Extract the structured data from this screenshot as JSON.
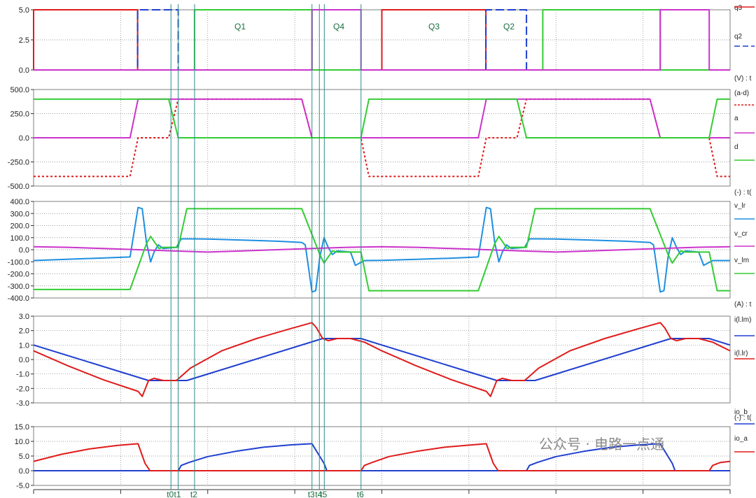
{
  "colors": {
    "grid": "#7f7f7f",
    "marker": "#2e8b8b",
    "q2": "#1f3fd0",
    "q3": "#e01b1b",
    "q1": "#33cc33",
    "q4": "#cc33cc"
  },
  "watermark": "公众号 · 电路一点通",
  "markers": [
    {
      "name": "t0",
      "t": 0.1972
    },
    {
      "name": "t1",
      "t": 0.2076
    },
    {
      "name": "t2",
      "t": 0.2311
    },
    {
      "name": "t3",
      "t": 0.3997
    },
    {
      "name": "t4",
      "t": 0.4103
    },
    {
      "name": "t5",
      "t": 0.4174
    },
    {
      "name": "t6",
      "t": 0.4701
    }
  ],
  "chart_data": [
    {
      "type": "line",
      "panel": "gate-drive",
      "title": "",
      "xlabel": "",
      "ylabel": "",
      "ylim": [
        0,
        5
      ],
      "yticks": [
        "5.0",
        "2.5",
        "0.0"
      ],
      "grid": true,
      "legend_position": "right",
      "annotations": [
        "Q1",
        "Q4",
        "Q3",
        "Q2"
      ],
      "series": [
        {
          "name": "q3",
          "color": "#e01b1b",
          "dash": "solid",
          "x": [
            0,
            0.0,
            0.0,
            0.1493,
            0.1493,
            0.5,
            0.5,
            0.6493,
            0.6493,
            1.0
          ],
          "y": [
            0,
            0,
            5,
            5,
            0,
            0,
            5,
            5,
            0,
            0
          ]
        },
        {
          "name": "q2",
          "color": "#1f3fd0",
          "dash": "dashed",
          "x": [
            0,
            0.1493,
            0.1493,
            0.2076,
            0.2076,
            0.6493,
            0.6493,
            0.7076,
            0.7076,
            1.0
          ],
          "y": [
            0,
            0,
            5,
            5,
            0,
            0,
            5,
            5,
            0,
            0
          ]
        },
        {
          "name": "Q1",
          "color": "#33cc33",
          "dash": "solid",
          "x": [
            0,
            0.2311,
            0.2311,
            0.3997,
            0.3997,
            0.7311,
            0.7311,
            0.8997,
            0.8997,
            1.0
          ],
          "y": [
            0,
            0,
            5,
            5,
            0,
            0,
            5,
            5,
            0,
            0
          ]
        },
        {
          "name": "Q4",
          "color": "#cc33cc",
          "dash": "solid",
          "x": [
            0,
            0.3997,
            0.3997,
            0.4701,
            0.4701,
            0.8997,
            0.8997,
            0.9701,
            0.9701,
            1.0
          ],
          "y": [
            0,
            0,
            5,
            5,
            0,
            0,
            5,
            5,
            0,
            0
          ]
        }
      ]
    },
    {
      "type": "line",
      "panel": "bridge-voltages",
      "title": "(V) : t",
      "xlabel": "",
      "ylabel": "",
      "ylim": [
        -500,
        500
      ],
      "yticks": [
        "500.0",
        "250.0",
        "0.0",
        "-250.0",
        "-500.0"
      ],
      "grid": true,
      "legend_position": "right",
      "series": [
        {
          "name": "(a-d)",
          "color": "#e01b1b",
          "dash": "dotted",
          "x": [
            0,
            0.1385,
            0.1499,
            0.194,
            0.2076,
            0.385,
            0.3997,
            0.47,
            0.4814,
            0.6385,
            0.6499,
            0.694,
            0.7076,
            0.885,
            0.8997,
            0.97,
            0.9814,
            1.0
          ],
          "y": [
            -400,
            -400,
            0,
            0,
            400,
            400,
            0,
            0,
            -400,
            -400,
            0,
            0,
            400,
            400,
            0,
            0,
            -400,
            -400
          ]
        },
        {
          "name": "a",
          "color": "#cc33cc",
          "dash": "solid",
          "x": [
            0,
            0.1385,
            0.1499,
            0.385,
            0.3997,
            0.6385,
            0.6499,
            0.885,
            0.8997,
            1.0
          ],
          "y": [
            0,
            0,
            400,
            400,
            0,
            0,
            400,
            400,
            0,
            0
          ]
        },
        {
          "name": "d",
          "color": "#33cc33",
          "dash": "solid",
          "x": [
            0,
            0.194,
            0.2076,
            0.47,
            0.4814,
            0.694,
            0.7076,
            0.97,
            0.9814,
            1.0
          ],
          "y": [
            400,
            400,
            0,
            0,
            400,
            400,
            0,
            0,
            400,
            400
          ]
        }
      ]
    },
    {
      "type": "line",
      "panel": "resonant-voltages",
      "title": "(-) : t(",
      "xlabel": "",
      "ylabel": "",
      "ylim": [
        -400,
        400
      ],
      "yticks": [
        "400.0",
        "300.0",
        "200.0",
        "100.0",
        "0.0",
        "-100.0",
        "-200.0",
        "-300.0",
        "-400.0"
      ],
      "grid": true,
      "legend_position": "right",
      "series": [
        {
          "name": "v_lr",
          "color": "#1e8fe0",
          "dash": "solid",
          "x": [
            0,
            0.1385,
            0.1499,
            0.156,
            0.162,
            0.168,
            0.173,
            0.179,
            0.186,
            0.205,
            0.212,
            0.225,
            0.25,
            0.3,
            0.35,
            0.385,
            0.39,
            0.3997,
            0.405,
            0.411,
            0.417,
            0.423,
            0.429,
            0.436,
            0.455,
            0.462,
            0.475,
            0.5,
            0.55,
            0.6,
            0.6385,
            0.6499,
            0.656,
            0.662,
            0.668,
            0.673,
            0.679,
            0.686,
            0.705,
            0.712,
            0.725,
            0.75,
            0.8,
            0.85,
            0.885,
            0.89,
            0.8997,
            0.905,
            0.911,
            0.917,
            0.923,
            0.929,
            0.936,
            0.955,
            0.962,
            0.975,
            1.0
          ],
          "y": [
            -90,
            -60,
            350,
            340,
            60,
            -100,
            -20,
            40,
            10,
            20,
            90,
            90,
            88,
            80,
            70,
            60,
            40,
            -350,
            -340,
            -60,
            100,
            20,
            -40,
            -10,
            -20,
            -130,
            -90,
            -88,
            -80,
            -70,
            -60,
            350,
            340,
            60,
            -100,
            -20,
            40,
            10,
            20,
            90,
            90,
            88,
            80,
            70,
            60,
            40,
            -350,
            -340,
            -60,
            100,
            20,
            -40,
            -10,
            -20,
            -130,
            -90,
            -90
          ]
        },
        {
          "name": "v_cr",
          "color": "#cc33cc",
          "dash": "solid",
          "x": [
            0,
            0.05,
            0.1,
            0.15,
            0.2,
            0.25,
            0.3,
            0.35,
            0.4,
            0.45,
            0.5,
            0.55,
            0.6,
            0.65,
            0.7,
            0.75,
            0.8,
            0.85,
            0.9,
            0.95,
            1.0
          ],
          "y": [
            25,
            20,
            10,
            0,
            -10,
            -20,
            -10,
            0,
            10,
            20,
            25,
            20,
            10,
            0,
            -10,
            -20,
            -10,
            0,
            10,
            20,
            25
          ]
        },
        {
          "name": "v_lm",
          "color": "#33cc33",
          "dash": "solid",
          "x": [
            0,
            0.1385,
            0.162,
            0.168,
            0.174,
            0.18,
            0.186,
            0.2076,
            0.22,
            0.385,
            0.411,
            0.417,
            0.423,
            0.429,
            0.436,
            0.4701,
            0.4814,
            0.6385,
            0.662,
            0.668,
            0.674,
            0.68,
            0.686,
            0.7076,
            0.72,
            0.885,
            0.911,
            0.917,
            0.923,
            0.929,
            0.936,
            0.9701,
            0.9814,
            1.0
          ],
          "y": [
            -330,
            -330,
            50,
            110,
            60,
            10,
            20,
            20,
            340,
            340,
            -40,
            -110,
            -60,
            -10,
            -20,
            -20,
            -340,
            -340,
            50,
            110,
            60,
            10,
            20,
            20,
            340,
            340,
            -40,
            -110,
            -60,
            -10,
            -20,
            -20,
            -340,
            -340
          ]
        }
      ]
    },
    {
      "type": "line",
      "panel": "inductor-currents",
      "title": "(A) : t",
      "xlabel": "",
      "ylabel": "",
      "ylim": [
        -3,
        3
      ],
      "yticks": [
        "3.0",
        "2.0",
        "1.0",
        "0.0",
        "-1.0",
        "-2.0",
        "-3.0"
      ],
      "grid": true,
      "legend_position": "right",
      "series": [
        {
          "name": "i(l.lm)",
          "color": "#1f3fd0",
          "dash": "solid",
          "x": [
            0,
            0.165,
            0.22,
            0.415,
            0.47,
            0.5,
            0.665,
            0.72,
            0.915,
            0.97,
            1.0
          ],
          "y": [
            1.0,
            -1.45,
            -1.45,
            1.45,
            1.45,
            1.0,
            -1.45,
            -1.45,
            1.45,
            1.45,
            1.0
          ]
        },
        {
          "name": "i(l.lr)",
          "color": "#e01b1b",
          "dash": "solid",
          "x": [
            0,
            0.05,
            0.1,
            0.1499,
            0.156,
            0.165,
            0.173,
            0.186,
            0.205,
            0.225,
            0.27,
            0.32,
            0.37,
            0.3997,
            0.406,
            0.415,
            0.423,
            0.436,
            0.455,
            0.475,
            0.5,
            0.55,
            0.6,
            0.6499,
            0.656,
            0.665,
            0.673,
            0.686,
            0.705,
            0.725,
            0.77,
            0.82,
            0.87,
            0.8997,
            0.906,
            0.915,
            0.923,
            0.936,
            0.955,
            0.975,
            1.0
          ],
          "y": [
            0.6,
            -0.45,
            -1.4,
            -2.2,
            -2.55,
            -1.45,
            -1.3,
            -1.45,
            -1.45,
            -0.6,
            0.6,
            1.45,
            2.15,
            2.55,
            2.2,
            1.45,
            1.3,
            1.45,
            1.45,
            1.2,
            0.6,
            -0.45,
            -1.4,
            -2.2,
            -2.55,
            -1.45,
            -1.3,
            -1.45,
            -1.45,
            -0.6,
            0.6,
            1.45,
            2.15,
            2.55,
            2.2,
            1.45,
            1.3,
            1.45,
            1.45,
            1.2,
            0.6
          ]
        }
      ]
    },
    {
      "type": "line",
      "panel": "output-currents",
      "title": "(-) : t(",
      "xlabel": "",
      "ylabel": "",
      "ylim": [
        -5,
        15
      ],
      "yticks": [
        "15.0",
        "10.0",
        "5.0",
        "0.0",
        "-5.0"
      ],
      "grid": true,
      "legend_position": "right",
      "series": [
        {
          "name": "io_b",
          "color": "#1f3fd0",
          "dash": "solid",
          "x": [
            0,
            0.2076,
            0.212,
            0.223,
            0.25,
            0.29,
            0.33,
            0.37,
            0.3997,
            0.417,
            0.421,
            0.7076,
            0.712,
            0.723,
            0.75,
            0.79,
            0.83,
            0.87,
            0.8997,
            0.917,
            0.921,
            1.0
          ],
          "y": [
            0,
            0,
            1.8,
            2.8,
            4.8,
            6.6,
            8.0,
            8.8,
            9.2,
            2.5,
            0,
            0,
            1.8,
            2.8,
            4.8,
            6.6,
            8.0,
            8.8,
            9.2,
            2.5,
            0,
            0
          ]
        },
        {
          "name": "io_a",
          "color": "#e01b1b",
          "dash": "solid",
          "x": [
            0,
            0.04,
            0.08,
            0.12,
            0.1499,
            0.16,
            0.167,
            0.4701,
            0.475,
            0.486,
            0.51,
            0.55,
            0.59,
            0.63,
            0.6499,
            0.66,
            0.667,
            0.9701,
            0.975,
            0.986,
            1.0
          ],
          "y": [
            3.2,
            5.6,
            7.4,
            8.6,
            9.2,
            2.5,
            0,
            0,
            1.8,
            2.8,
            4.8,
            6.6,
            8.0,
            8.8,
            9.2,
            2.5,
            0,
            0,
            1.8,
            2.8,
            3.2
          ]
        }
      ]
    }
  ]
}
